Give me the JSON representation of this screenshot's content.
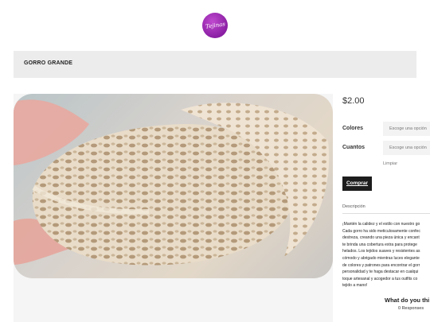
{
  "header": {
    "logo_text": "Tejinas"
  },
  "title_bar": {
    "title": "GORRO GRANDE"
  },
  "product": {
    "price": "$2.00",
    "colores_label": "Colores",
    "colores_placeholder": "Escoge una opción",
    "cuantos_label": "Cuantos",
    "cuantos_placeholder": "Escoge una opción",
    "clear_label": "Limpiar",
    "buy_label": "Comprar"
  },
  "description": {
    "tab_label": "Descripción",
    "text": "¡Mantén la calidez y el estilo con nuestro go\nCada gorro ha sido meticulosamente confec\ndestreza, creando una pieza única y encant\nte brinda una cobertura extra para protege\nhelados. Los tejidos suaves y resistentes as\ncómodo y abrigado mientras luces elegante\nde colores y patrones para encontrar el gorr\npersonalidad y te haga destacar en cualqui\ntoque artesanal y acogedor a tus outfits co\ntejido a mano!"
  },
  "feedback": {
    "question": "What do you thi",
    "responses": "0 Responses"
  }
}
